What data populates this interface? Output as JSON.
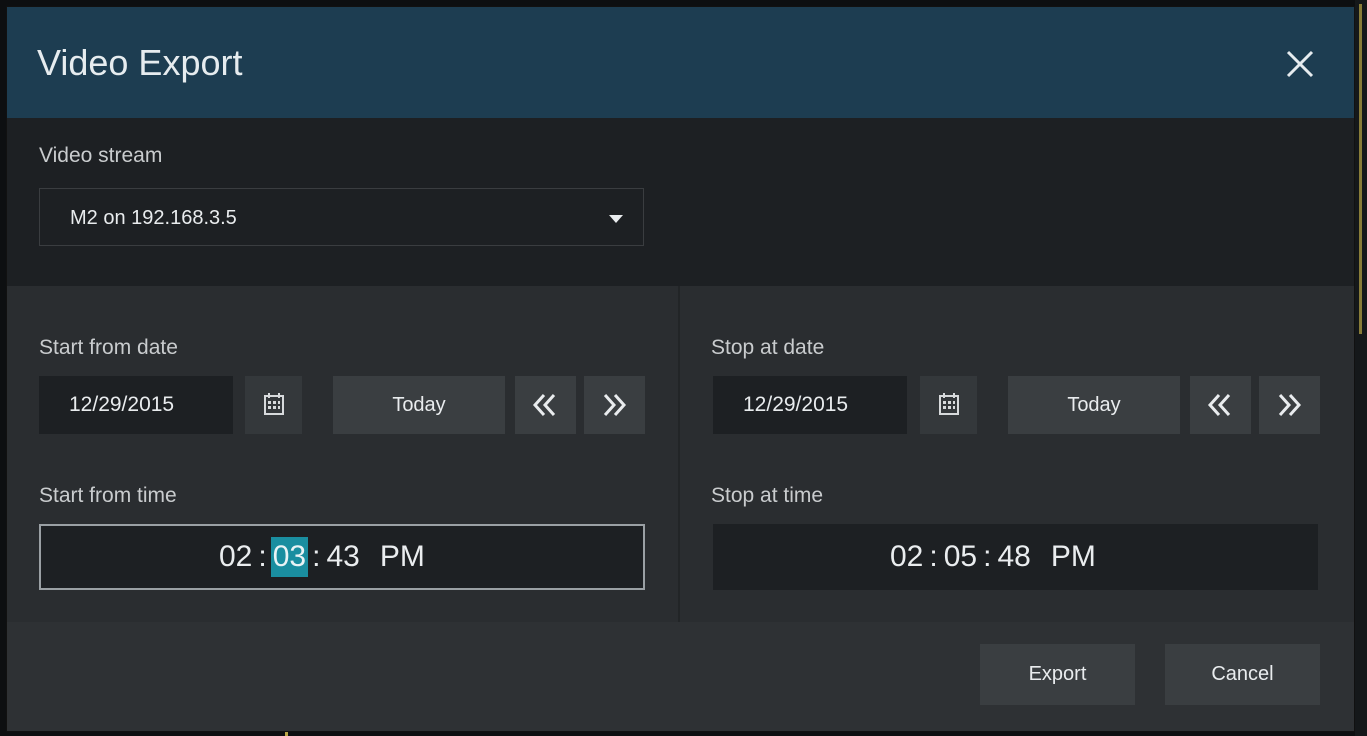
{
  "dialog": {
    "title": "Video Export",
    "close_icon": "close-icon"
  },
  "stream": {
    "label": "Video stream",
    "selected": "M2 on 192.168.3.5"
  },
  "start": {
    "date_label": "Start from date",
    "date": "12/29/2015",
    "today_label": "Today",
    "time_label": "Start from time",
    "hour": "02",
    "minute": "03",
    "second": "43",
    "ampm": "PM",
    "separator": ":"
  },
  "stop": {
    "date_label": "Stop at date",
    "date": "12/29/2015",
    "today_label": "Today",
    "time_label": "Stop at time",
    "hour": "02",
    "minute": "05",
    "second": "48",
    "ampm": "PM",
    "separator": ":"
  },
  "footer": {
    "export_label": "Export",
    "cancel_label": "Cancel"
  },
  "colors": {
    "titlebar": "#1d3d51",
    "selected_segment": "#1a8ea0"
  }
}
